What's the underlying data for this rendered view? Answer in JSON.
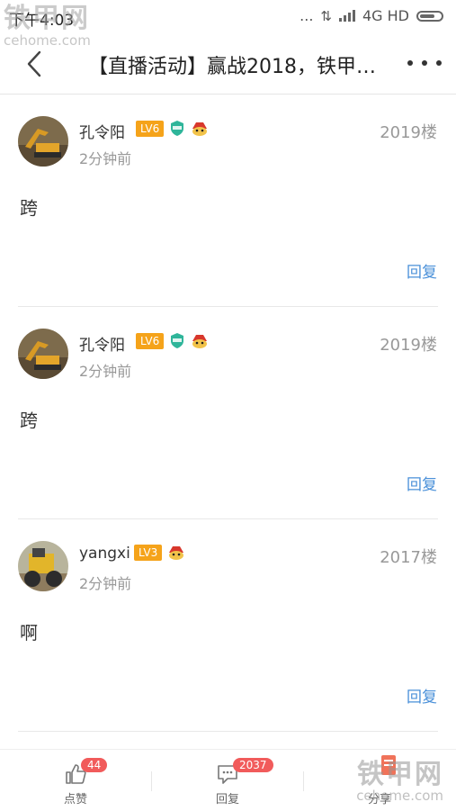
{
  "status_bar": {
    "time": "下午4:03",
    "dots": "...",
    "network": "4G HD"
  },
  "watermark": {
    "brand": "铁甲网",
    "domain": "cehome.com"
  },
  "header": {
    "title": "【直播活动】赢战2018，铁甲…"
  },
  "posts": [
    {
      "username": "孔令阳",
      "level": "LV6",
      "time": "2分钟前",
      "floor": "2019楼",
      "content": "跨",
      "reply_label": "回复",
      "has_shield_badge": true
    },
    {
      "username": "孔令阳",
      "level": "LV6",
      "time": "2分钟前",
      "floor": "2019楼",
      "content": "跨",
      "reply_label": "回复",
      "has_shield_badge": true
    },
    {
      "username": "yangxi",
      "level": "LV3",
      "time": "2分钟前",
      "floor": "2017楼",
      "content": "啊",
      "reply_label": "回复",
      "has_shield_badge": false
    }
  ],
  "bottom_bar": {
    "like": {
      "label": "点赞",
      "badge": "44"
    },
    "reply": {
      "label": "回复",
      "badge": "2037"
    },
    "share": {
      "label": "分享"
    }
  },
  "colors": {
    "link": "#4a90d9",
    "level_badge": "#f5a31a",
    "count_badge": "#f15b5b"
  }
}
